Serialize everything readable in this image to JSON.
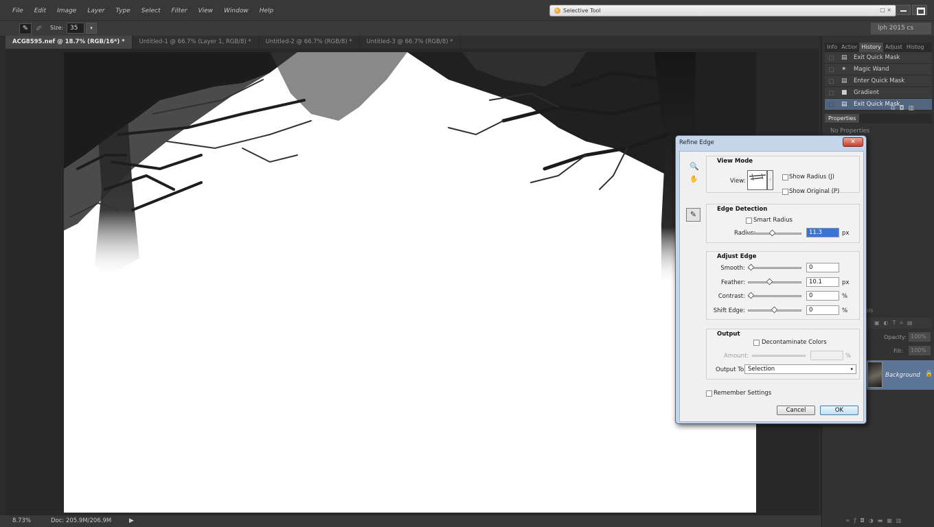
{
  "menubar": {
    "items": [
      "File",
      "Edit",
      "Image",
      "Layer",
      "Type",
      "Select",
      "Filter",
      "View",
      "Window",
      "Help"
    ]
  },
  "workspace": {
    "app_label": "Selective Tool",
    "controls": "□ ×",
    "name": "lph 2015 cs"
  },
  "options": {
    "tool_icon": "refine-radius-brush-icon",
    "size_label": "Size:",
    "size_value": "35"
  },
  "tabs": [
    {
      "label": "ACG8595.nef @ 18.7% (RGB/16*) *",
      "active": true
    },
    {
      "label": "Untitled-1 @ 66.7% (Layer 1, RGB/8) *",
      "active": false
    },
    {
      "label": "Untitled-2 @ 66.7% (RGB/8) *",
      "active": false
    },
    {
      "label": "Untitled-3 @ 66.7% (RGB/8) *",
      "active": false
    }
  ],
  "status": {
    "zoom": "8.73%",
    "doc": "Doc: 205.9M/206.9M"
  },
  "panels": {
    "tabs": [
      "Info",
      "Actior",
      "History",
      "Adjust",
      "Histog"
    ],
    "active_tab": "History",
    "history": [
      {
        "label": "Exit Quick Mask",
        "icon": "quick-mask-icon",
        "selected": false
      },
      {
        "label": "Magic Wand",
        "icon": "magic-wand-icon",
        "selected": false
      },
      {
        "label": "Enter Quick Mask",
        "icon": "quick-mask-icon",
        "selected": false
      },
      {
        "label": "Gradient",
        "icon": "gradient-icon",
        "selected": false
      },
      {
        "label": "Exit Quick Mask",
        "icon": "quick-mask-icon",
        "selected": true
      }
    ],
    "properties_title": "Properties",
    "properties_body": "No Properties",
    "layers_tab": "nels",
    "opacity_label": "Opacity:",
    "opacity_value": "100%",
    "fill_label": "Fill:",
    "fill_value": "100%",
    "layer_name": "Background"
  },
  "dialog": {
    "title": "Refine Edge",
    "close": "✕",
    "view_mode": {
      "title": "View Mode",
      "view_label": "View:",
      "show_radius": "Show Radius (J)",
      "show_original": "Show Original (P)"
    },
    "edge_detection": {
      "title": "Edge Detection",
      "smart_radius": "Smart Radius",
      "radius_label": "Radius:",
      "radius_value": "11.3",
      "radius_fraction": 0.45,
      "radius_unit": "px"
    },
    "adjust_edge": {
      "title": "Adjust Edge",
      "smooth_label": "Smooth:",
      "smooth_value": "0",
      "smooth_fraction": 0,
      "feather_label": "Feather:",
      "feather_value": "10.1",
      "feather_fraction": 0.4,
      "feather_unit": "px",
      "contrast_label": "Contrast:",
      "contrast_value": "0",
      "contrast_fraction": 0,
      "contrast_unit": "%",
      "shift_label": "Shift Edge:",
      "shift_value": "0",
      "shift_fraction": 0.5,
      "shift_unit": "%"
    },
    "output": {
      "title": "Output",
      "decontaminate": "Decontaminate Colors",
      "amount_label": "Amount:",
      "amount_unit": "%",
      "output_to_label": "Output To:",
      "output_to_value": "Selection"
    },
    "remember": "Remember Settings",
    "cancel": "Cancel",
    "ok": "OK"
  }
}
